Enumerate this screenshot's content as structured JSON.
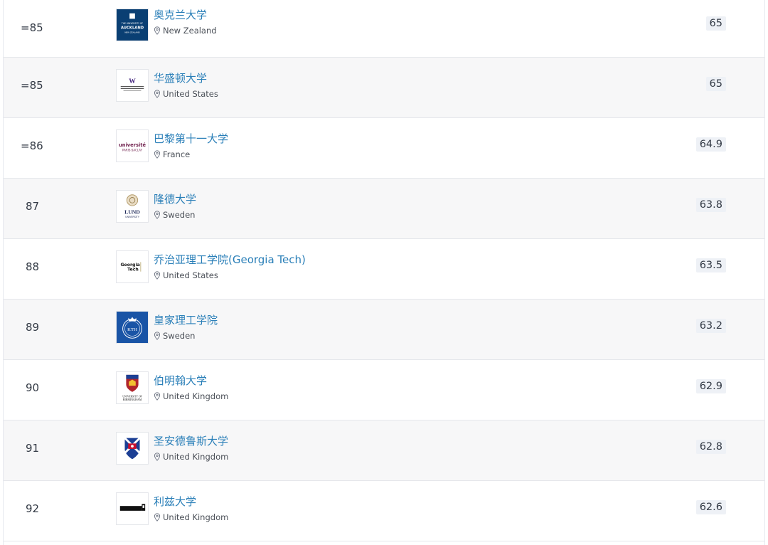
{
  "rows": [
    {
      "rank": "=85",
      "name": "奥克兰大学",
      "country": "New Zealand",
      "score": "65",
      "logo": "auckland-logo",
      "logo_text": [
        "THE UNIVERSITY OF",
        "AUCKLAND",
        "NEW ZEALAND"
      ]
    },
    {
      "rank": "=85",
      "name": "华盛顿大学",
      "country": "United States",
      "score": "65",
      "logo": "washington-logo",
      "logo_text": [
        "W"
      ]
    },
    {
      "rank": "=86",
      "name": "巴黎第十一大学",
      "country": "France",
      "score": "64.9",
      "logo": "paris-saclay-logo",
      "logo_text": [
        "université",
        "PARIS-SACLAY"
      ]
    },
    {
      "rank": "87",
      "name": "隆德大学",
      "country": "Sweden",
      "score": "63.8",
      "logo": "lund-logo",
      "logo_text": [
        "LUND",
        "UNIVERSITY"
      ]
    },
    {
      "rank": "88",
      "name": "乔治亚理工学院(Georgia Tech)",
      "country": "United States",
      "score": "63.5",
      "logo": "georgia-tech-logo",
      "logo_text": [
        "Georgia",
        "Tech"
      ]
    },
    {
      "rank": "89",
      "name": "皇家理工学院",
      "country": "Sweden",
      "score": "63.2",
      "logo": "kth-logo",
      "logo_text": [
        "KTH"
      ]
    },
    {
      "rank": "90",
      "name": "伯明翰大学",
      "country": "United Kingdom",
      "score": "62.9",
      "logo": "birmingham-logo",
      "logo_text": [
        "UNIVERSITY OF",
        "BIRMINGHAM"
      ]
    },
    {
      "rank": "91",
      "name": "圣安德鲁斯大学",
      "country": "United Kingdom",
      "score": "62.8",
      "logo": "st-andrews-logo",
      "logo_text": []
    },
    {
      "rank": "92",
      "name": "利兹大学",
      "country": "United Kingdom",
      "score": "62.6",
      "logo": "leeds-logo",
      "logo_text": []
    }
  ],
  "colors": {
    "name_link": "#2a7fb8",
    "score_badge_bg": "#eef1f6",
    "row_alt_bg": "#f7f7f8",
    "auckland_blue": "#0a3f73",
    "washington_purple": "#4b2e83",
    "saclay_purple": "#6e1d4b",
    "kth_blue": "#1954a6",
    "birmingham_red": "#b1252c"
  }
}
